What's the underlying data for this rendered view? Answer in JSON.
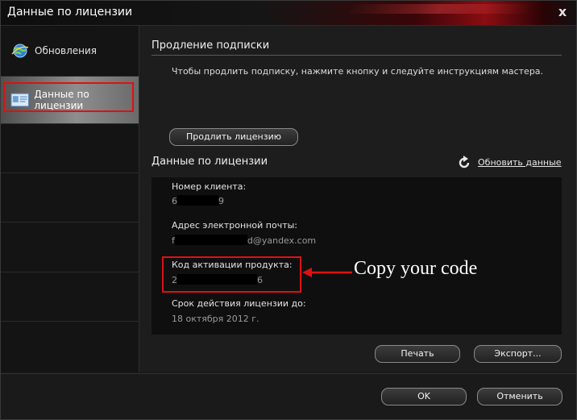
{
  "window": {
    "title": "Данные по лицензии",
    "close_glyph": "x"
  },
  "sidebar": {
    "items": [
      {
        "label": "Обновления",
        "icon": "globe-icon"
      },
      {
        "label": "Данные по лицензии",
        "icon": "license-card-icon",
        "selected": true
      }
    ]
  },
  "main": {
    "renewal": {
      "title": "Продление подписки",
      "text": "Чтобы продлить подписку, нажмите кнопку и следуйте инструкциям мастера.",
      "button": "Продлить лицензию"
    },
    "license": {
      "title": "Данные по лицензии",
      "refresh_label": "Обновить данные",
      "fields": {
        "client_number_label": "Номер клиента:",
        "client_number_start": "6",
        "client_number_end": "9",
        "email_label": "Адрес электронной почты:",
        "email_start": "f",
        "email_end": "d@yandex.com",
        "activation_label": "Код активации продукта:",
        "activation_start": "2",
        "activation_end": "6",
        "expiry_label": "Срок действия лицензии до:",
        "expiry_value": "18 октября 2012 г."
      },
      "print_button": "Печать",
      "export_button": "Экспорт..."
    }
  },
  "annotation": {
    "text": "Copy your code",
    "color": "#e01010"
  },
  "footer": {
    "ok": "OK",
    "cancel": "Отменить"
  },
  "colors": {
    "highlight_red": "#e01010",
    "selected_item": "#8e8e8e"
  }
}
